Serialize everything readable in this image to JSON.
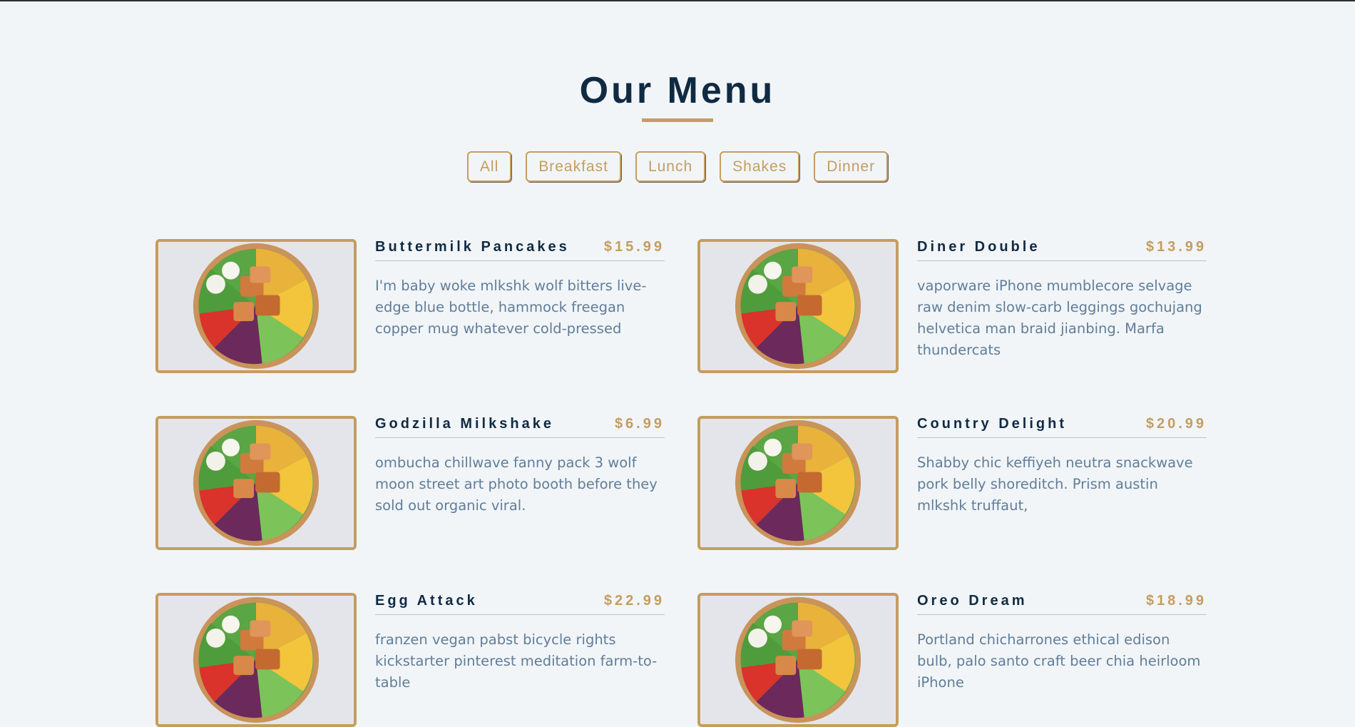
{
  "page": {
    "title": "Our Menu"
  },
  "filters": [
    {
      "label": "All"
    },
    {
      "label": "Breakfast"
    },
    {
      "label": "Lunch"
    },
    {
      "label": "Shakes"
    },
    {
      "label": "Dinner"
    }
  ],
  "items": [
    {
      "name": "Buttermilk Pancakes",
      "price": "$15.99",
      "desc": "I'm baby woke mlkshk wolf bitters live-edge blue bottle, hammock freegan copper mug whatever cold-pressed"
    },
    {
      "name": "Diner Double",
      "price": "$13.99",
      "desc": "vaporware iPhone mumblecore selvage raw denim slow-carb leggings gochujang helvetica man braid jianbing. Marfa thundercats"
    },
    {
      "name": "Godzilla Milkshake",
      "price": "$6.99",
      "desc": "ombucha chillwave fanny pack 3 wolf moon street art photo booth before they sold out organic viral."
    },
    {
      "name": "Country Delight",
      "price": "$20.99",
      "desc": "Shabby chic keffiyeh neutra snackwave pork belly shoreditch. Prism austin mlkshk truffaut,"
    },
    {
      "name": "Egg Attack",
      "price": "$22.99",
      "desc": "franzen vegan pabst bicycle rights kickstarter pinterest meditation farm-to-table"
    },
    {
      "name": "Oreo Dream",
      "price": "$18.99",
      "desc": "Portland chicharrones ethical edison bulb, palo santo craft beer chia heirloom iPhone"
    }
  ],
  "colors": {
    "accent": "#c59d5f",
    "heading": "#102a42",
    "text": "#617d98",
    "background": "#f1f5f8"
  }
}
